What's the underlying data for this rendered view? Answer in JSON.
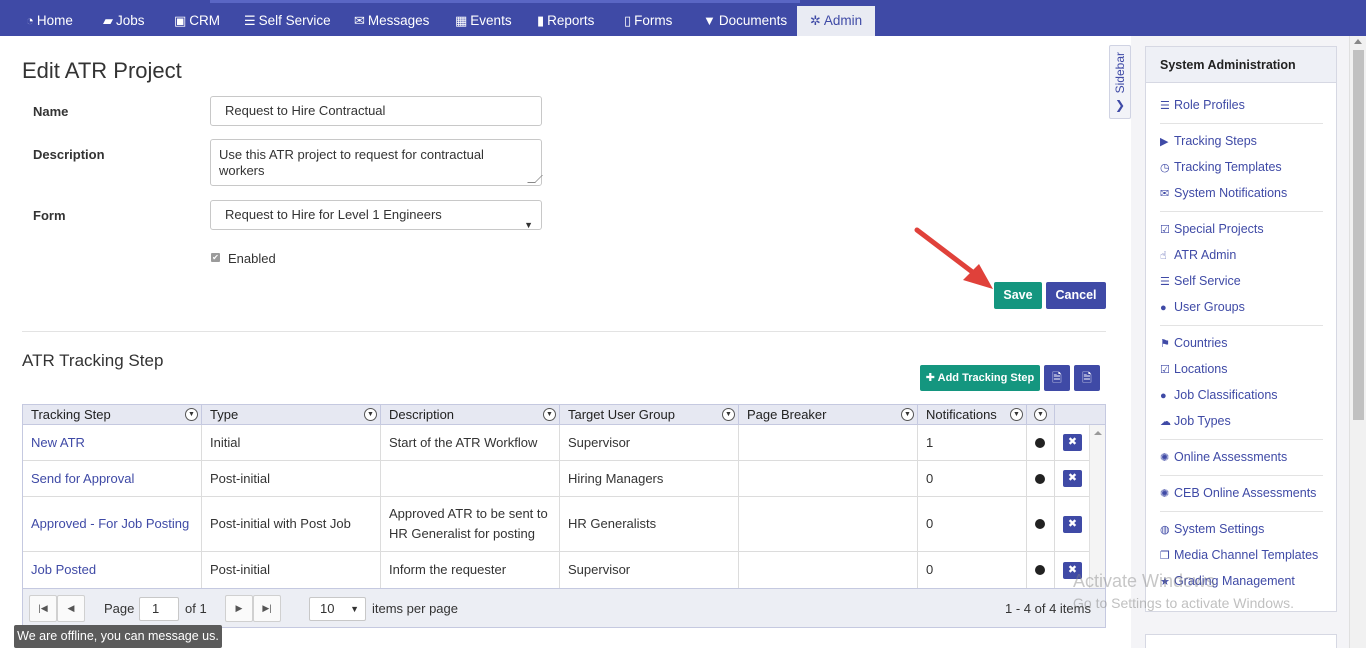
{
  "nav": {
    "items": [
      {
        "label": "Home",
        "icon": "dashboard-icon"
      },
      {
        "label": "Jobs",
        "icon": "folder-open-icon"
      },
      {
        "label": "CRM",
        "icon": "briefcase-icon"
      },
      {
        "label": "Self Service",
        "icon": "list-icon"
      },
      {
        "label": "Messages",
        "icon": "envelope-icon"
      },
      {
        "label": "Events",
        "icon": "calendar-icon"
      },
      {
        "label": "Reports",
        "icon": "book-icon"
      },
      {
        "label": "Forms",
        "icon": "file-icon"
      },
      {
        "label": "Documents",
        "icon": "filter-icon"
      },
      {
        "label": "Admin",
        "icon": "gear-icon",
        "active": true
      }
    ]
  },
  "page": {
    "title": "Edit ATR Project"
  },
  "form": {
    "name_label": "Name",
    "name_value": "Request to Hire Contractual",
    "description_label": "Description",
    "description_value": "Use this ATR project to request for contractual workers",
    "form_label": "Form",
    "form_value": "Request to Hire for Level 1 Engineers",
    "enabled_label": "Enabled",
    "enabled_checked": true,
    "save_label": "Save",
    "cancel_label": "Cancel"
  },
  "tracking": {
    "section_title": "ATR Tracking Step",
    "add_label": "Add Tracking Step",
    "columns": [
      "Tracking Step",
      "Type",
      "Description",
      "Target User Group",
      "Page Breaker",
      "Notifications"
    ],
    "rows": [
      {
        "step": "New ATR",
        "type": "Initial",
        "description": "Start of the ATR Workflow",
        "group": "Supervisor",
        "page_breaker": "",
        "notifications": "1"
      },
      {
        "step": "Send for Approval",
        "type": "Post-initial",
        "description": "",
        "group": "Hiring Managers",
        "page_breaker": "",
        "notifications": "0"
      },
      {
        "step": "Approved - For Job Posting",
        "type": "Post-initial with Post Job",
        "description": "Approved ATR to be sent to HR Generalist for posting",
        "group": "HR Generalists",
        "page_breaker": "",
        "notifications": "0"
      },
      {
        "step": "Job Posted",
        "type": "Post-initial",
        "description": "Inform the requester",
        "group": "Supervisor",
        "page_breaker": "",
        "notifications": "0"
      }
    ],
    "pager": {
      "page_label": "Page",
      "page_value": "1",
      "of_label": "of 1",
      "page_size": "10",
      "items_per_page_label": "items per page",
      "summary": "1 - 4 of 4 items"
    }
  },
  "sidebar_tab": {
    "label": "Sidebar"
  },
  "admin_panel": {
    "title": "System Administration",
    "groups": [
      [
        {
          "label": "Role Profiles",
          "icon": "server-icon"
        }
      ],
      [
        {
          "label": "Tracking Steps",
          "icon": "step-forward-icon"
        },
        {
          "label": "Tracking Templates",
          "icon": "clock-icon"
        },
        {
          "label": "System Notifications",
          "icon": "envelope-icon"
        }
      ],
      [
        {
          "label": "Special Projects",
          "icon": "check-square-icon"
        },
        {
          "label": "ATR Admin",
          "icon": "thumbs-up-icon"
        },
        {
          "label": "Self Service",
          "icon": "list-icon"
        },
        {
          "label": "User Groups",
          "icon": "user-icon"
        }
      ],
      [
        {
          "label": "Countries",
          "icon": "flag-icon"
        },
        {
          "label": "Locations",
          "icon": "check-square-icon"
        },
        {
          "label": "Job Classifications",
          "icon": "user-icon"
        },
        {
          "label": "Job Types",
          "icon": "cloud-icon"
        }
      ],
      [
        {
          "label": "Online Assessments",
          "icon": "asterisk-icon"
        }
      ],
      [
        {
          "label": "CEB Online Assessments",
          "icon": "asterisk-icon"
        }
      ],
      [
        {
          "label": "System Settings",
          "icon": "globe-icon"
        },
        {
          "label": "Media Channel Templates",
          "icon": "copy-icon"
        },
        {
          "label": "Grading Management",
          "icon": "star-icon"
        }
      ]
    ]
  },
  "chat": {
    "offline_text": "We are offline, you can message us."
  },
  "watermark": {
    "line1": "Activate Windows",
    "line2": "Go to Settings to activate Windows."
  },
  "colors": {
    "brand": "#3f4aa6",
    "save": "#14967f",
    "annotation_arrow": "#e0413a"
  }
}
